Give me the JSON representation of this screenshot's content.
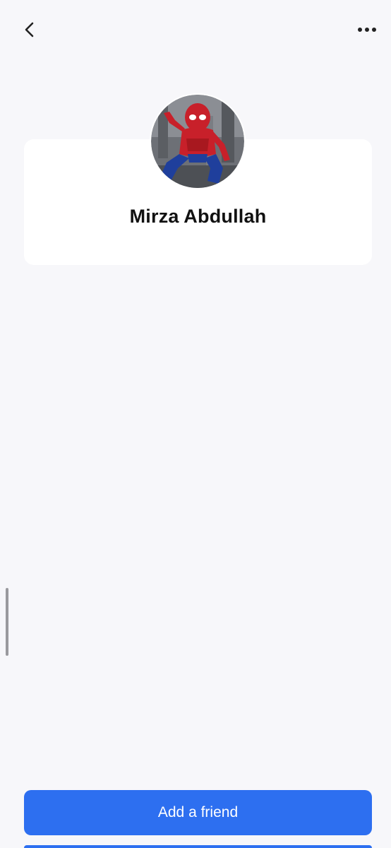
{
  "header": {
    "back_icon": "chevron-left-icon",
    "more_icon": "more-horizontal-icon"
  },
  "profile": {
    "name": "Mirza Abdullah",
    "avatar_description": "spider-man-avatar"
  },
  "actions": {
    "add_friend_label": "Add a friend"
  },
  "colors": {
    "background": "#f7f7fa",
    "card": "#ffffff",
    "primary": "#2d6ff0",
    "text": "#111111"
  }
}
